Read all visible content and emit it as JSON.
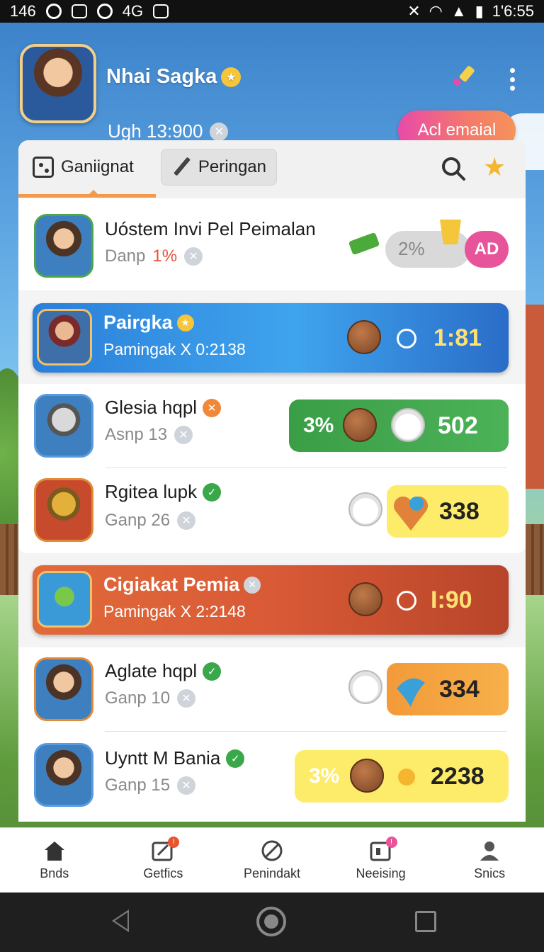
{
  "status_bar": {
    "left_text": "146",
    "network_label": "4G",
    "time": "1'6:55"
  },
  "header": {
    "user_name": "Nhai Sagka",
    "user_sub": "Ugh 13:900",
    "cta_label": "Acl emaial"
  },
  "tabs": {
    "active_label": "Ganiignat",
    "inactive_label": "Peringan"
  },
  "rows": [
    {
      "name": "Uóstem Invi Pel Peimalan",
      "sub_prefix": "Danp",
      "sub_value": "1%",
      "pill_pct": "2%",
      "ad_label": "AD"
    },
    {
      "name": "Pairgka",
      "sub": "Pamingak  X 0:2138",
      "value": "1:81"
    },
    {
      "name": "Glesia hqpl",
      "sub": "Asnp 13",
      "pill_pct": "3%",
      "value": "502"
    },
    {
      "name": "Rgitea lupk",
      "sub": "Ganp 26",
      "value": "338"
    },
    {
      "name": "Cigiakat Pemia",
      "sub": "Pamingak  X 2:2148",
      "value": "I:90"
    },
    {
      "name": "Aglate hqpl",
      "sub": "Ganp 10",
      "value": "334"
    },
    {
      "name": "Uyntt M Bania",
      "sub": "Ganp 15",
      "pill_pct": "3%",
      "value": "2238"
    }
  ],
  "bottom_nav": [
    {
      "label": "Bnds",
      "icon": "home-icon"
    },
    {
      "label": "Getfics",
      "icon": "edit-icon"
    },
    {
      "label": "Penindakt",
      "icon": "block-icon"
    },
    {
      "label": "Neeising",
      "icon": "message-icon"
    },
    {
      "label": "Snics",
      "icon": "profile-icon"
    }
  ],
  "colors": {
    "accent_orange": "#f39a4a",
    "banner_blue": "#2a7fd8",
    "banner_red": "#d95a36",
    "cta_pink": "#e84aa8",
    "gold": "#ffe173"
  }
}
